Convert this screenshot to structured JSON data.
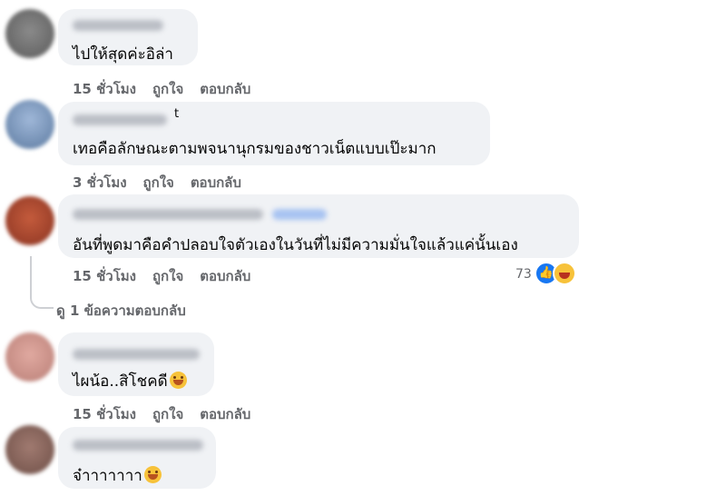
{
  "comments": [
    {
      "text": "ไปให้สุดค่ะอิล่า",
      "time": "15 ชั่วโมง",
      "like": "ถูกใจ",
      "reply": "ตอบกลับ"
    },
    {
      "name_fragment": "t",
      "text": "เทอคือลักษณะตามพจนานุกรมของชาวเน็ตแบบเป๊ะมาก",
      "time": "3 ชั่วโมง",
      "like": "ถูกใจ",
      "reply": "ตอบกลับ"
    },
    {
      "text": "อันที่พูดมาคือคำปลอบใจตัวเองในวันที่ไม่มีความมั่นใจแล้วแค่นั้นเอง",
      "time": "15 ชั่วโมง",
      "like": "ถูกใจ",
      "reply": "ตอบกลับ",
      "reaction_count": "73",
      "view_replies": "ดู 1 ข้อความตอบกลับ"
    },
    {
      "text": "ไผน้อ..สิโชคดี",
      "time": "15 ชั่วโมง",
      "like": "ถูกใจ",
      "reply": "ตอบกลับ"
    },
    {
      "text": "จ๋าาาาาาา"
    }
  ],
  "colors": {
    "bubble": "#f0f2f5",
    "meta": "#65676b",
    "like_blue": "#1877f2",
    "emoji_yellow": "#f7c23a"
  },
  "icons": [
    "grinning-emoji-icon",
    "like-reaction-icon",
    "haha-reaction-icon"
  ]
}
